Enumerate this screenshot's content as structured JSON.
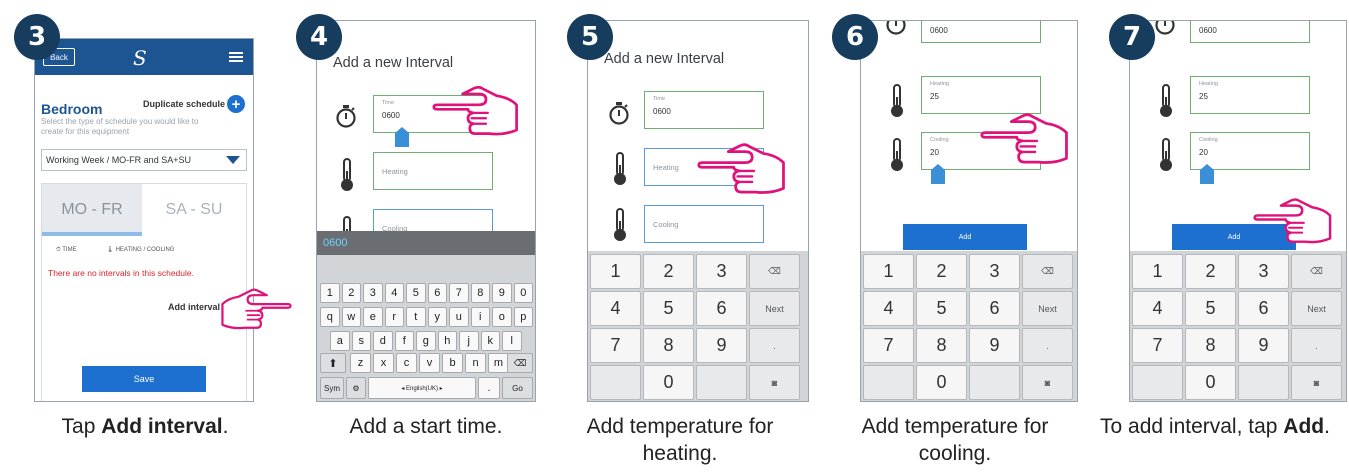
{
  "steps": [
    {
      "number": "3",
      "caption_pre": "Tap ",
      "caption_bold": "Add interval",
      "caption_post": "."
    },
    {
      "number": "4",
      "caption_pre": "Add a start time.",
      "caption_bold": "",
      "caption_post": ""
    },
    {
      "number": "5",
      "caption_pre": "Add temperature for heating.",
      "caption_bold": "",
      "caption_post": ""
    },
    {
      "number": "6",
      "caption_pre": "Add temperature for cooling.",
      "caption_bold": "",
      "caption_post": ""
    },
    {
      "number": "7",
      "caption_pre": "To add interval, tap ",
      "caption_bold": "Add",
      "caption_post": "."
    }
  ],
  "screen3": {
    "back_label": "Back",
    "logo": "S",
    "room": "Bedroom",
    "duplicate_label": "Duplicate schedule",
    "hint": "Select the type of schedule you would like to create for this equipment",
    "select_value": "Working Week / MO-FR and SA+SU",
    "tab1": "MO - FR",
    "tab2": "SA - SU",
    "col_time": "TIME",
    "col_temp": "HEATING / COOLING",
    "no_intervals": "There are no intervals in this schedule.",
    "add_interval": "Add interval",
    "save": "Save"
  },
  "form": {
    "title": "Add a new Interval",
    "time_label": "Time",
    "time_value": "0600",
    "heating_label": "Heating",
    "heating_value": "25",
    "cooling_label": "Cooling",
    "cooling_value": "20",
    "add": "Add"
  },
  "qwerty": {
    "entry": "0600",
    "row1": [
      "1",
      "2",
      "3",
      "4",
      "5",
      "6",
      "7",
      "8",
      "9",
      "0"
    ],
    "row2": [
      "q",
      "w",
      "e",
      "r",
      "t",
      "y",
      "u",
      "i",
      "o",
      "p"
    ],
    "row3": [
      "a",
      "s",
      "d",
      "f",
      "g",
      "h",
      "j",
      "k",
      "l"
    ],
    "row4": [
      "z",
      "x",
      "c",
      "v",
      "b",
      "n",
      "m"
    ],
    "sym": "Sym",
    "lang": "◂ English(UK) ▸",
    "go": "Go",
    "dot": "."
  },
  "numpad": {
    "keys": [
      "1",
      "2",
      "3",
      "4",
      "5",
      "6",
      "7",
      "8",
      "9",
      "0"
    ],
    "next": "Next",
    "dot": "."
  },
  "colors": {
    "badge": "#173d5e",
    "appbar": "#1d5592",
    "button": "#1d6fd0",
    "hand": "#e0127a",
    "error": "#d8252e"
  }
}
